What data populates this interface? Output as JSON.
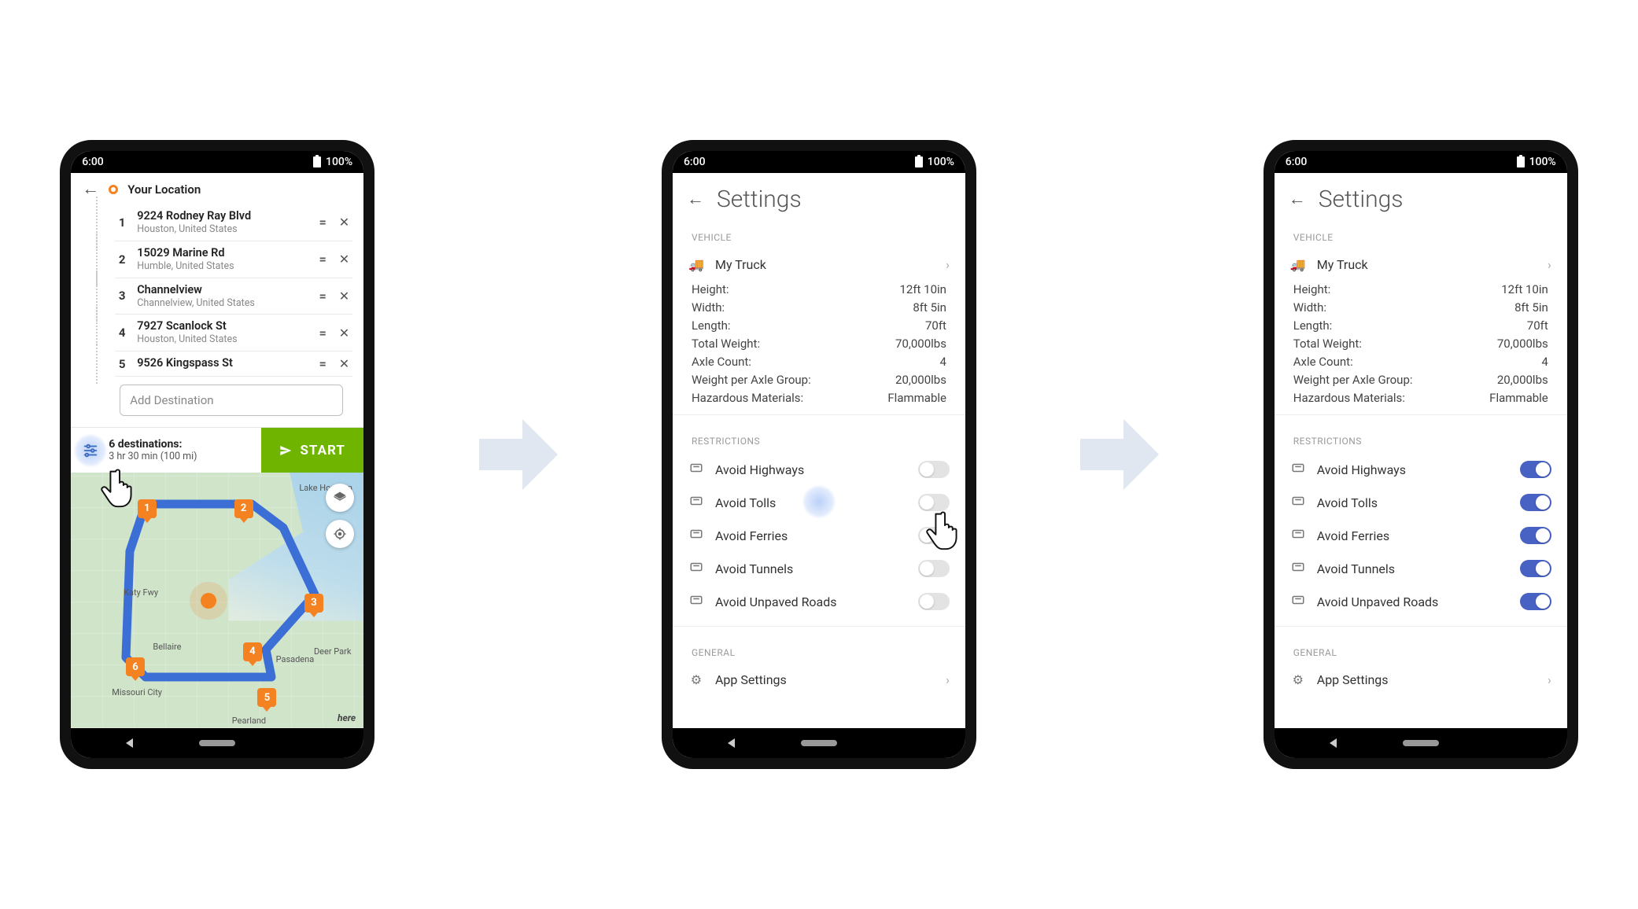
{
  "status": {
    "time": "6:00",
    "battery": "100%"
  },
  "route": {
    "origin_label": "Your Location",
    "stops": [
      {
        "n": "1",
        "title": "9224 Rodney Ray Blvd",
        "sub": "Houston, United States"
      },
      {
        "n": "2",
        "title": "15029 Marine Rd",
        "sub": "Humble, United States"
      },
      {
        "n": "3",
        "title": "Channelview",
        "sub": "Channelview, United States"
      },
      {
        "n": "4",
        "title": "7927 Scanlock St",
        "sub": "Houston, United States"
      },
      {
        "n": "5",
        "title": "9526 Kingspass St",
        "sub": ""
      }
    ],
    "add_destination_placeholder": "Add Destination",
    "summary_title": "6 destinations:",
    "summary_sub": "3 hr 30 min (100 mi)",
    "start_label": "START",
    "map_pins": [
      "1",
      "2",
      "3",
      "4",
      "5",
      "6"
    ],
    "map_labels": {
      "lake_houston": "Lake Houston",
      "bellaire": "Bellaire",
      "pasadena": "Pasadena",
      "deer_park": "Deer Park",
      "missouri_city": "Missouri City",
      "pearland": "Pearland",
      "katy_fwy": "Katy Fwy"
    },
    "here_attr": "here"
  },
  "settings": {
    "title": "Settings",
    "sections": {
      "vehicle": "VEHICLE",
      "restrictions": "RESTRICTIONS",
      "general": "GENERAL"
    },
    "vehicle_name": "My Truck",
    "specs": [
      {
        "k": "Height:",
        "v": "12ft 10in"
      },
      {
        "k": "Width:",
        "v": "8ft 5in"
      },
      {
        "k": "Length:",
        "v": "70ft"
      },
      {
        "k": "Total Weight:",
        "v": "70,000lbs"
      },
      {
        "k": "Axle Count:",
        "v": "4"
      },
      {
        "k": "Weight per Axle Group:",
        "v": "20,000lbs"
      },
      {
        "k": "Hazardous Materials:",
        "v": "Flammable"
      }
    ],
    "restrictions": [
      {
        "label": "Avoid Highways",
        "icon": "highway-icon",
        "glyph": "🛣"
      },
      {
        "label": "Avoid Tolls",
        "icon": "toll-icon",
        "glyph": "⛩"
      },
      {
        "label": "Avoid Ferries",
        "icon": "ferry-icon",
        "glyph": "⛴"
      },
      {
        "label": "Avoid Tunnels",
        "icon": "tunnel-icon",
        "glyph": "⾞"
      },
      {
        "label": "Avoid Unpaved Roads",
        "icon": "unpaved-icon",
        "glyph": "꩜"
      }
    ],
    "app_settings_label": "App Settings",
    "phone2_toggle_states": [
      "off",
      "off",
      "off",
      "off",
      "off"
    ],
    "phone3_toggle_states": [
      "on",
      "on",
      "on",
      "on",
      "on"
    ]
  }
}
